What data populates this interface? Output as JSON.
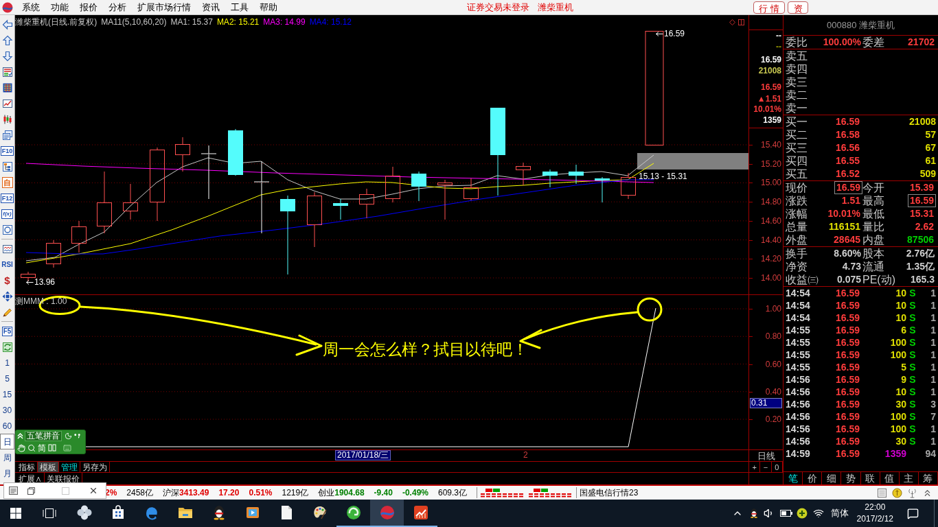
{
  "menu_bar": {
    "items": [
      "系统",
      "功能",
      "报价",
      "分析",
      "扩展市场行情",
      "资讯",
      "工具",
      "帮助"
    ],
    "login_status": "证券交易未登录",
    "stock_name": "潍柴重机",
    "buttons": [
      "行 情",
      "资"
    ]
  },
  "left_toolbar": {
    "badges": [
      "F10",
      "自",
      "F12",
      "f(x)",
      "RSI",
      "$",
      "F5"
    ],
    "periods": [
      {
        "label": "1",
        "selected": false
      },
      {
        "label": "5",
        "selected": false
      },
      {
        "label": "15",
        "selected": false
      },
      {
        "label": "30",
        "selected": false
      },
      {
        "label": "60",
        "selected": false
      },
      {
        "label": "日",
        "selected": true
      },
      {
        "label": "周",
        "selected": false
      },
      {
        "label": "月",
        "selected": false
      }
    ]
  },
  "price_chart": {
    "title": "潍柴重机(日线.前复权)",
    "indicator": "MA11(5,10,60,20)",
    "averages": [
      {
        "label": "MA1: 15.37",
        "color": "#c8c8c8"
      },
      {
        "label": "MA2: 15.21",
        "color": "#ffff00"
      },
      {
        "label": "MA3: 14.99",
        "color": "#ff00ff"
      },
      {
        "label": "MA4: 15.12",
        "color": "#0000ff"
      }
    ],
    "high_label": "16.59",
    "low_label": "13.96",
    "range_label": "15.13 - 15.31",
    "axis_labels": [
      "15.40",
      "15.20",
      "15.00",
      "14.80",
      "14.60",
      "14.40",
      "14.20",
      "14.00"
    ],
    "summary": [
      {
        "text": "--",
        "color": "#ffffff"
      },
      {
        "text": "--",
        "color": "#a0a000"
      },
      {
        "text": "16.59",
        "color": "#ffffff"
      },
      {
        "text": "21008",
        "color": "#c8c850"
      },
      {
        "text": "16.59",
        "color": "#ff3c3c"
      },
      {
        "text": "▲1.51",
        "color": "#ff3c3c"
      },
      {
        "text": "10.01%",
        "color": "#ff3c3c"
      },
      {
        "text": "1359",
        "color": "#ffffff"
      }
    ]
  },
  "indicator_chart": {
    "label": "测MMM : 1.00",
    "axis_labels": [
      "1.00",
      "0.80",
      "0.60",
      "0.40",
      "0.20"
    ],
    "cursor_value": "0.31",
    "note": "周一会怎么样？拭目以待吧！"
  },
  "date_axis": {
    "cursor_date": "2017/01/18/三",
    "ticks": [
      "2"
    ],
    "period": "日线",
    "zoom_buttons": [
      "+",
      "−",
      "0"
    ]
  },
  "bottom_tabs": [
    {
      "label": "指标",
      "selected": false,
      "hovered": false
    },
    {
      "label": "模板",
      "selected": false,
      "hovered": true
    },
    {
      "label": "管理",
      "selected": true,
      "hovered": false
    },
    {
      "label": "另存为",
      "selected": false,
      "hovered": false
    }
  ],
  "bottom_links": [
    "扩展∧",
    "关联报价"
  ],
  "quote_panel": {
    "header": "000880 潍柴重机",
    "order_stats": [
      {
        "label": "委比",
        "value": "100.00%"
      },
      {
        "label": "委差",
        "value": "21702"
      }
    ],
    "asks": [
      "卖五",
      "卖四",
      "卖三",
      "卖二",
      "卖一"
    ],
    "bids": [
      {
        "label": "买一",
        "price": "16.59",
        "volume": "21008"
      },
      {
        "label": "买二",
        "price": "16.58",
        "volume": "57"
      },
      {
        "label": "买三",
        "price": "16.56",
        "volume": "67"
      },
      {
        "label": "买四",
        "price": "16.55",
        "volume": "61"
      },
      {
        "label": "买五",
        "price": "16.52",
        "volume": "509"
      }
    ],
    "stats": [
      [
        {
          "label": "现价",
          "value": "16.59",
          "color": "#ff3c3c",
          "highlighted": true
        },
        {
          "label": "今开",
          "value": "15.39",
          "color": "#ff3c3c",
          "highlighted": false
        }
      ],
      [
        {
          "label": "涨跌",
          "value": "1.51",
          "color": "#ff3c3c",
          "highlighted": false
        },
        {
          "label": "最高",
          "value": "16.59",
          "color": "#ff3c3c",
          "highlighted": true
        }
      ],
      [
        {
          "label": "涨幅",
          "value": "10.01%",
          "color": "#ff3c3c",
          "highlighted": false
        },
        {
          "label": "最低",
          "value": "15.31",
          "color": "#ff3c3c",
          "highlighted": false
        }
      ],
      [
        {
          "label": "总量",
          "value": "116151",
          "color": "#e0e000",
          "highlighted": false
        },
        {
          "label": "量比",
          "value": "2.62",
          "color": "#ff3c3c",
          "highlighted": false
        }
      ],
      [
        {
          "label": "外盘",
          "value": "28645",
          "color": "#ff3c3c",
          "highlighted": false
        },
        {
          "label": "内盘",
          "value": "87506",
          "color": "#00d000",
          "highlighted": false
        }
      ]
    ],
    "fundamentals": [
      [
        {
          "label": "换手",
          "value": "8.60%"
        },
        {
          "label": "股本",
          "value": "2.76亿"
        }
      ],
      [
        {
          "label": "净资",
          "value": "4.73"
        },
        {
          "label": "流通",
          "value": "1.35亿"
        }
      ],
      [
        {
          "label": "收益㈢",
          "value": "0.075"
        },
        {
          "label": "PE(动)",
          "value": "165.3"
        }
      ]
    ],
    "trades": [
      {
        "time": "14:54",
        "price": "16.59",
        "volume": "10",
        "side": "S",
        "count": "1",
        "color": "#e0e000"
      },
      {
        "time": "14:54",
        "price": "16.59",
        "volume": "10",
        "side": "S",
        "count": "1",
        "color": "#e0e000"
      },
      {
        "time": "14:54",
        "price": "16.59",
        "volume": "10",
        "side": "S",
        "count": "1",
        "color": "#e0e000"
      },
      {
        "time": "14:55",
        "price": "16.59",
        "volume": "6",
        "side": "S",
        "count": "1",
        "color": "#e0e000"
      },
      {
        "time": "14:55",
        "price": "16.59",
        "volume": "100",
        "side": "S",
        "count": "1",
        "color": "#e0e000"
      },
      {
        "time": "14:55",
        "price": "16.59",
        "volume": "100",
        "side": "S",
        "count": "1",
        "color": "#e0e000"
      },
      {
        "time": "14:55",
        "price": "16.59",
        "volume": "5",
        "side": "S",
        "count": "1",
        "color": "#e0e000"
      },
      {
        "time": "14:56",
        "price": "16.59",
        "volume": "9",
        "side": "S",
        "count": "1",
        "color": "#e0e000"
      },
      {
        "time": "14:56",
        "price": "16.59",
        "volume": "10",
        "side": "S",
        "count": "1",
        "color": "#e0e000"
      },
      {
        "time": "14:56",
        "price": "16.59",
        "volume": "30",
        "side": "S",
        "count": "3",
        "color": "#e0e000"
      },
      {
        "time": "14:56",
        "price": "16.59",
        "volume": "100",
        "side": "S",
        "count": "7",
        "color": "#e0e000"
      },
      {
        "time": "14:56",
        "price": "16.59",
        "volume": "100",
        "side": "S",
        "count": "1",
        "color": "#e0e000"
      },
      {
        "time": "14:56",
        "price": "16.59",
        "volume": "30",
        "side": "S",
        "count": "1",
        "color": "#e0e000"
      },
      {
        "time": "14:59",
        "price": "16.59",
        "volume": "1359",
        "count": "94",
        "color": "#d000d0"
      }
    ],
    "tabs": [
      {
        "label": "笔",
        "selected": true
      },
      {
        "label": "价",
        "selected": false
      },
      {
        "label": "细",
        "selected": false
      },
      {
        "label": "势",
        "selected": false
      },
      {
        "label": "联",
        "selected": false
      },
      {
        "label": "值",
        "selected": false
      },
      {
        "label": "主",
        "selected": false
      },
      {
        "label": "筹",
        "selected": false
      }
    ]
  },
  "ime_bar": {
    "mode": "五笔拼音",
    "charset": "简"
  },
  "status_bar": {
    "indices": [
      {
        "percent": "2%",
        "turnover": "2458亿",
        "color": "#e00000"
      },
      {
        "name": "沪深",
        "value": "3413.49",
        "change": "17.20",
        "percent": "0.51%",
        "turnover": "1219亿",
        "color": "#e00000"
      },
      {
        "name": "创业",
        "value": "1904.68",
        "change": "-9.40",
        "percent": "-0.49%",
        "turnover": "609.3亿",
        "color": "#008000"
      }
    ],
    "server": "国盛电信行情23"
  },
  "taskbar": {
    "apps": [
      {
        "running": false,
        "selected": false
      },
      {
        "running": false,
        "selected": false
      },
      {
        "running": false,
        "selected": false
      },
      {
        "running": false,
        "selected": false
      },
      {
        "running": false,
        "selected": false
      },
      {
        "running": false,
        "selected": false
      },
      {
        "running": false,
        "selected": false
      },
      {
        "running": false,
        "selected": false
      },
      {
        "running": true,
        "selected": false
      },
      {
        "running": true,
        "selected": true
      },
      {
        "running": true,
        "selected": false
      }
    ],
    "language": "简体",
    "time": "22:00",
    "date": "2017/2/12"
  }
}
